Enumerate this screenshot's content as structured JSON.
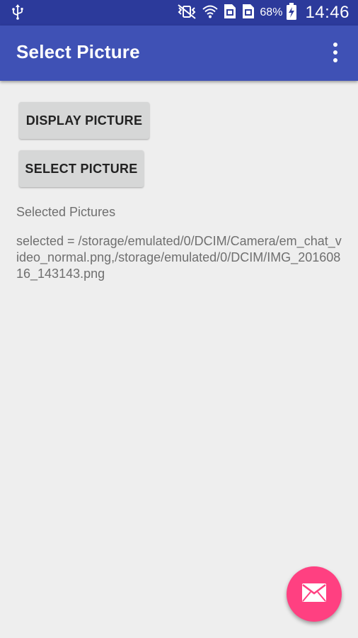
{
  "status_bar": {
    "battery_percent": "68%",
    "time": "14:46",
    "icons": [
      "usb-icon",
      "vibrate-icon",
      "wifi-icon",
      "sim1-icon",
      "sim2-icon",
      "battery-charging-icon"
    ]
  },
  "app_bar": {
    "title": "Select Picture",
    "overflow_icon": "more-vert-icon"
  },
  "content": {
    "display_button_label": "DISPLAY PICTURE",
    "select_button_label": "SELECT PICTURE",
    "section_label": "Selected Pictures",
    "selected_text": "selected = /storage/emulated/0/DCIM/Camera/em_chat_video_normal.png,/storage/emulated/0/DCIM/IMG_20160816_143143.png"
  },
  "fab": {
    "icon": "email-icon"
  },
  "colors": {
    "status_bar": "#2c3a9b",
    "app_bar": "#3f51b5",
    "background": "#eeeeee",
    "button": "#d6d7d7",
    "fab": "#ff4081"
  }
}
